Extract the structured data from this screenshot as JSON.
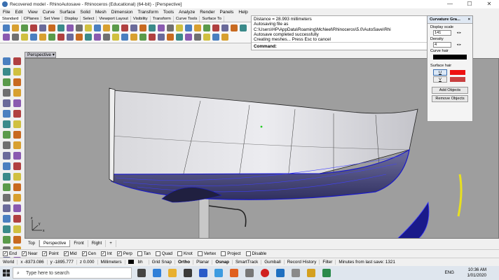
{
  "window": {
    "title": "Recovered model - RhinoAutosave - Rhinoceros (Educational) (64-bit) - [Perspective]",
    "minimize": "—",
    "maximize": "☐",
    "close": "✕"
  },
  "menu": [
    "File",
    "Edit",
    "View",
    "Curve",
    "Surface",
    "Solid",
    "Mesh",
    "Dimension",
    "Transform",
    "Tools",
    "Analyze",
    "Render",
    "Panels",
    "Help"
  ],
  "command_history": [
    "Distance = 28.993 millimeters",
    "Autosaving file as C:\\Users\\HP\\AppData\\Roaming\\McNeel\\Rhinoceros\\5.0\\AutoSave\\Rhi",
    "Autosave completed successfully",
    "Creating meshes... Press Esc to cancel"
  ],
  "command_prompt": "Command:",
  "toolbar_tabs": [
    "Standard",
    "CPlanes",
    "Set View",
    "Display",
    "Select",
    "Viewport Layout",
    "Visibility",
    "Transform",
    "Curve Tools",
    "Surface To"
  ],
  "viewport": {
    "name": "Perspective",
    "dropdown": "▾",
    "tabs": [
      "Top",
      "Perspective",
      "Front",
      "Right",
      "+"
    ],
    "active_tab": "Perspective"
  },
  "curvature_panel": {
    "title": "Curvature Gra...",
    "close": "×",
    "display_scale_label": "Display scale",
    "display_scale_value": "141",
    "density_label": "Density",
    "density_value": "4",
    "curve_hair_label": "Curve hair",
    "surface_hair_label": "Surface hair",
    "u_label": "U",
    "v_label": "V",
    "add_objects": "Add Objects",
    "remove_objects": "Remove Objects",
    "colors": {
      "curve_hair": "#000000",
      "u": "#ee1111",
      "v": "#c84040"
    }
  },
  "osnap": [
    {
      "label": "End",
      "checked": true
    },
    {
      "label": "Near",
      "checked": true
    },
    {
      "label": "Point",
      "checked": true
    },
    {
      "label": "Mid",
      "checked": true
    },
    {
      "label": "Cen",
      "checked": true
    },
    {
      "label": "Int",
      "checked": true
    },
    {
      "label": "Perp",
      "checked": true
    },
    {
      "label": "Tan",
      "checked": false
    },
    {
      "label": "Quad",
      "checked": false
    },
    {
      "label": "Knot",
      "checked": false
    },
    {
      "label": "Vertex",
      "checked": false
    },
    {
      "label": "Project",
      "checked": false
    },
    {
      "label": "Disable",
      "checked": false
    }
  ],
  "statusbar": {
    "cplane": "World",
    "x": "x -8373.086",
    "y": "y -1895.777",
    "z": "z 0.000",
    "units": "Millimeters",
    "layer": "bh",
    "grid_snap": "Grid Snap",
    "ortho": "Ortho",
    "planar": "Planar",
    "osnap": "Osnap",
    "smarttrack": "SmartTrack",
    "gumball": "Gumball",
    "record_history": "Record History",
    "filter": "Filter",
    "autosave": "Minutes from last save: 1321"
  },
  "taskbar": {
    "search_placeholder": "Type here to search",
    "language": "ENG",
    "time": "10:36 AM",
    "date": "1/01/2020"
  },
  "accent": "#1a1ac8"
}
